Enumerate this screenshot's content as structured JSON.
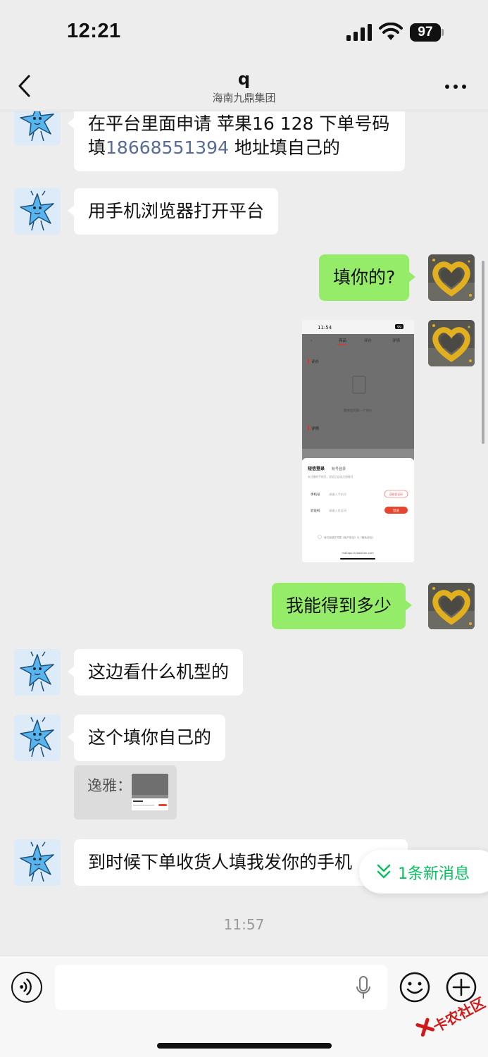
{
  "status_bar": {
    "time": "12:21",
    "battery": "97"
  },
  "header": {
    "title": "q",
    "subtitle": "海南九鼎集团"
  },
  "messages": [
    {
      "text_before": "在平台里面申请 苹果16 128  下单号码填",
      "phone": "18668551394",
      "text_after": " 地址填自己的"
    },
    {
      "text": "用手机浏览器打开平台"
    },
    {
      "text": "填你的?"
    },
    {
      "text": "我能得到多少"
    },
    {
      "text": "这边看什么机型的"
    },
    {
      "text": "这个填你自己的"
    },
    {
      "text": "到时候下单收货人填我发你的手机"
    }
  ],
  "screenshot": {
    "time": "11:54",
    "battery": "99",
    "tabs": [
      "商品",
      "评价",
      "详情"
    ],
    "tab_selected": "商品",
    "sections": [
      "评价",
      "详情"
    ],
    "empty_text": "期待您的第一个评价",
    "login_tabs": [
      "短信登录",
      "账号登录"
    ],
    "login_hint": "未注册的手机号，验证后自动注册账号",
    "phone_label": "手机号",
    "phone_placeholder": "请输入手机号",
    "get_code": "获取验证码",
    "code_label": "验证码",
    "code_placeholder": "请输入验证码",
    "login_button": "登录",
    "agreement": "我已阅读并同意《用户协议》与《隐私协议》",
    "url": "mallapp.hybaishan.com"
  },
  "quote": {
    "sender": "逸雅："
  },
  "timestamp": "11:57",
  "new_messages": "1条新消息",
  "watermark": "卡农社区",
  "colors": {
    "out_bubble": "#95ec69",
    "link": "#576b95",
    "accent_green": "#07c160"
  }
}
